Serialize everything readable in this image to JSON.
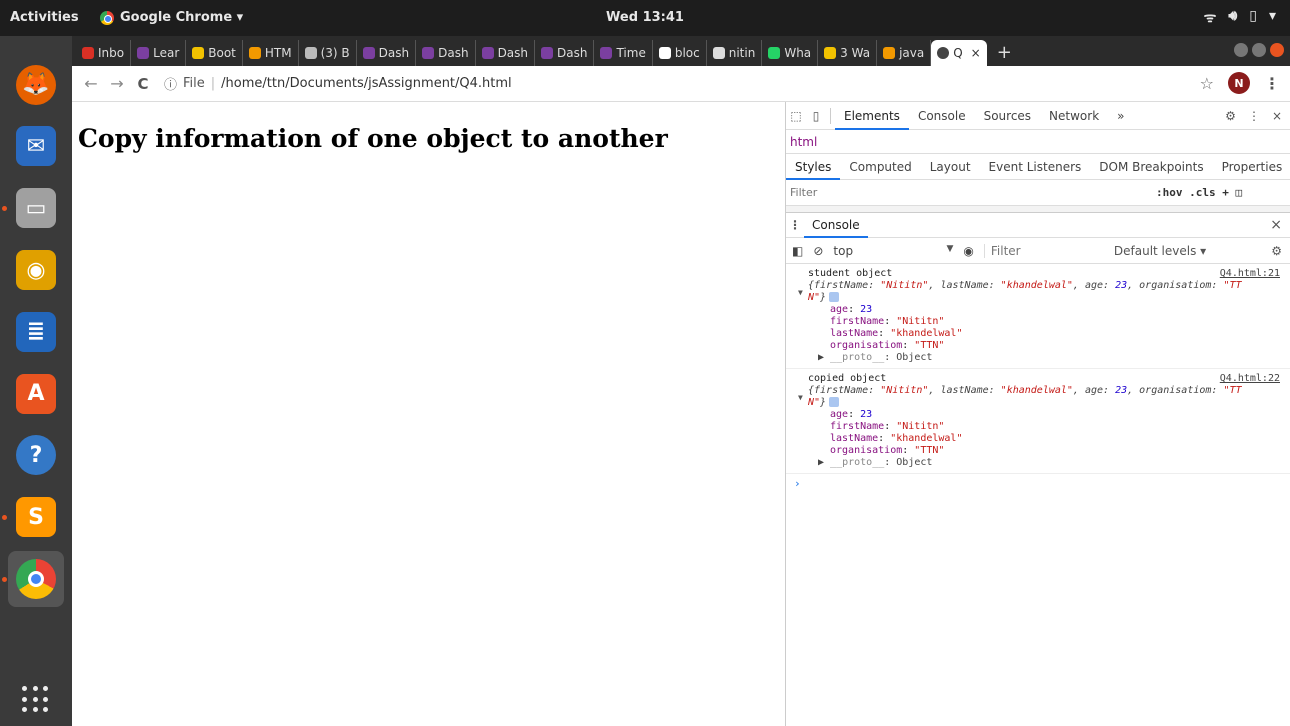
{
  "topbar": {
    "activities": "Activities",
    "app": "Google Chrome ▾",
    "clock": "Wed 13:41",
    "sys_icons": [
      "wifi-icon",
      "volume-icon",
      "battery-icon",
      "chevron-down-icon"
    ]
  },
  "dock": {
    "apps": [
      {
        "name": "firefox",
        "color": "#e66000",
        "glyph": "🦊"
      },
      {
        "name": "thunderbird",
        "color": "#2a6ac0",
        "glyph": "✉"
      },
      {
        "name": "files",
        "color": "#a0a0a0",
        "glyph": "▭"
      },
      {
        "name": "rhythmbox",
        "color": "#e0a000",
        "glyph": "◉"
      },
      {
        "name": "libreoffice-writer",
        "color": "#2266bb",
        "glyph": "≣"
      },
      {
        "name": "software-center",
        "color": "#e95420",
        "glyph": "A"
      },
      {
        "name": "help",
        "color": "#3478c6",
        "glyph": "?"
      },
      {
        "name": "sublime-text",
        "color": "#ff9800",
        "glyph": "S"
      },
      {
        "name": "chrome",
        "color": "#4285f4",
        "glyph": ""
      }
    ]
  },
  "tabs": [
    {
      "label": "Inbo",
      "color": "#d93025"
    },
    {
      "label": "Lear",
      "color": "#7b3fa0"
    },
    {
      "label": "Boot",
      "color": "#f2c200"
    },
    {
      "label": "HTM",
      "color": "#f29900"
    },
    {
      "label": "(3) B",
      "color": "#bbbbbb"
    },
    {
      "label": "Dash",
      "color": "#7b3fa0"
    },
    {
      "label": "Dash",
      "color": "#7b3fa0"
    },
    {
      "label": "Dash",
      "color": "#7b3fa0"
    },
    {
      "label": "Dash",
      "color": "#7b3fa0"
    },
    {
      "label": "Time",
      "color": "#7b3fa0"
    },
    {
      "label": "bloc",
      "color": "#ffffff"
    },
    {
      "label": "nitin",
      "color": "#dddddd"
    },
    {
      "label": "Wha",
      "color": "#25d366"
    },
    {
      "label": "3 Wa",
      "color": "#f2c200"
    },
    {
      "label": "java",
      "color": "#f29900"
    }
  ],
  "active_tab": {
    "label": "Q",
    "close": "×"
  },
  "new_tab": "+",
  "toolbar": {
    "back": "←",
    "forward": "→",
    "reload": "C",
    "info": "ⓘ",
    "scheme": "File",
    "url": "/home/ttn/Documents/jsAssignment/Q4.html",
    "star": "☆",
    "avatar": "N",
    "menu": "⋮"
  },
  "page": {
    "heading": "Copy information of one object to another"
  },
  "devtools": {
    "tabs": [
      "Elements",
      "Console",
      "Sources",
      "Network",
      "»"
    ],
    "active_tab": "Elements",
    "breadcrumb": "html",
    "styles_tabs": [
      "Styles",
      "Computed",
      "Layout",
      "Event Listeners",
      "DOM Breakpoints",
      "Properties",
      "»"
    ],
    "filter_placeholder": "Filter",
    "filter_tools": ":hov .cls + ◫",
    "drawer_tab": "Console",
    "context": "top",
    "console_filter_placeholder": "Filter",
    "levels": "Default levels ▾",
    "logs": [
      {
        "label": "student object",
        "source": "Q4.html:21",
        "summary": {
          "a": "{firstName: ",
          "v1": "\"Nititn\"",
          "b": ", lastName: ",
          "v2": "\"khandelwal\"",
          "c": ", age: ",
          "v3": "23",
          "d": ", organisatiom: ",
          "v4": "\"TT",
          "v5": "N\"",
          "e": "}"
        },
        "props": [
          {
            "key": "age",
            "value": "23",
            "type": "num"
          },
          {
            "key": "firstName",
            "value": "\"Nititn\"",
            "type": "str"
          },
          {
            "key": "lastName",
            "value": "\"khandelwal\"",
            "type": "str"
          },
          {
            "key": "organisatiom",
            "value": "\"TTN\"",
            "type": "str"
          }
        ],
        "proto": "__proto__",
        "proto_value": ": Object"
      },
      {
        "label": "copied object",
        "source": "Q4.html:22",
        "summary": {
          "a": "{firstName: ",
          "v1": "\"Nititn\"",
          "b": ", lastName: ",
          "v2": "\"khandelwal\"",
          "c": ", age: ",
          "v3": "23",
          "d": ", organisatiom: ",
          "v4": "\"TT",
          "v5": "N\"",
          "e": "}"
        },
        "props": [
          {
            "key": "age",
            "value": "23",
            "type": "num"
          },
          {
            "key": "firstName",
            "value": "\"Nititn\"",
            "type": "str"
          },
          {
            "key": "lastName",
            "value": "\"khandelwal\"",
            "type": "str"
          },
          {
            "key": "organisatiom",
            "value": "\"TTN\"",
            "type": "str"
          }
        ],
        "proto": "__proto__",
        "proto_value": ": Object"
      }
    ],
    "prompt": "›"
  }
}
